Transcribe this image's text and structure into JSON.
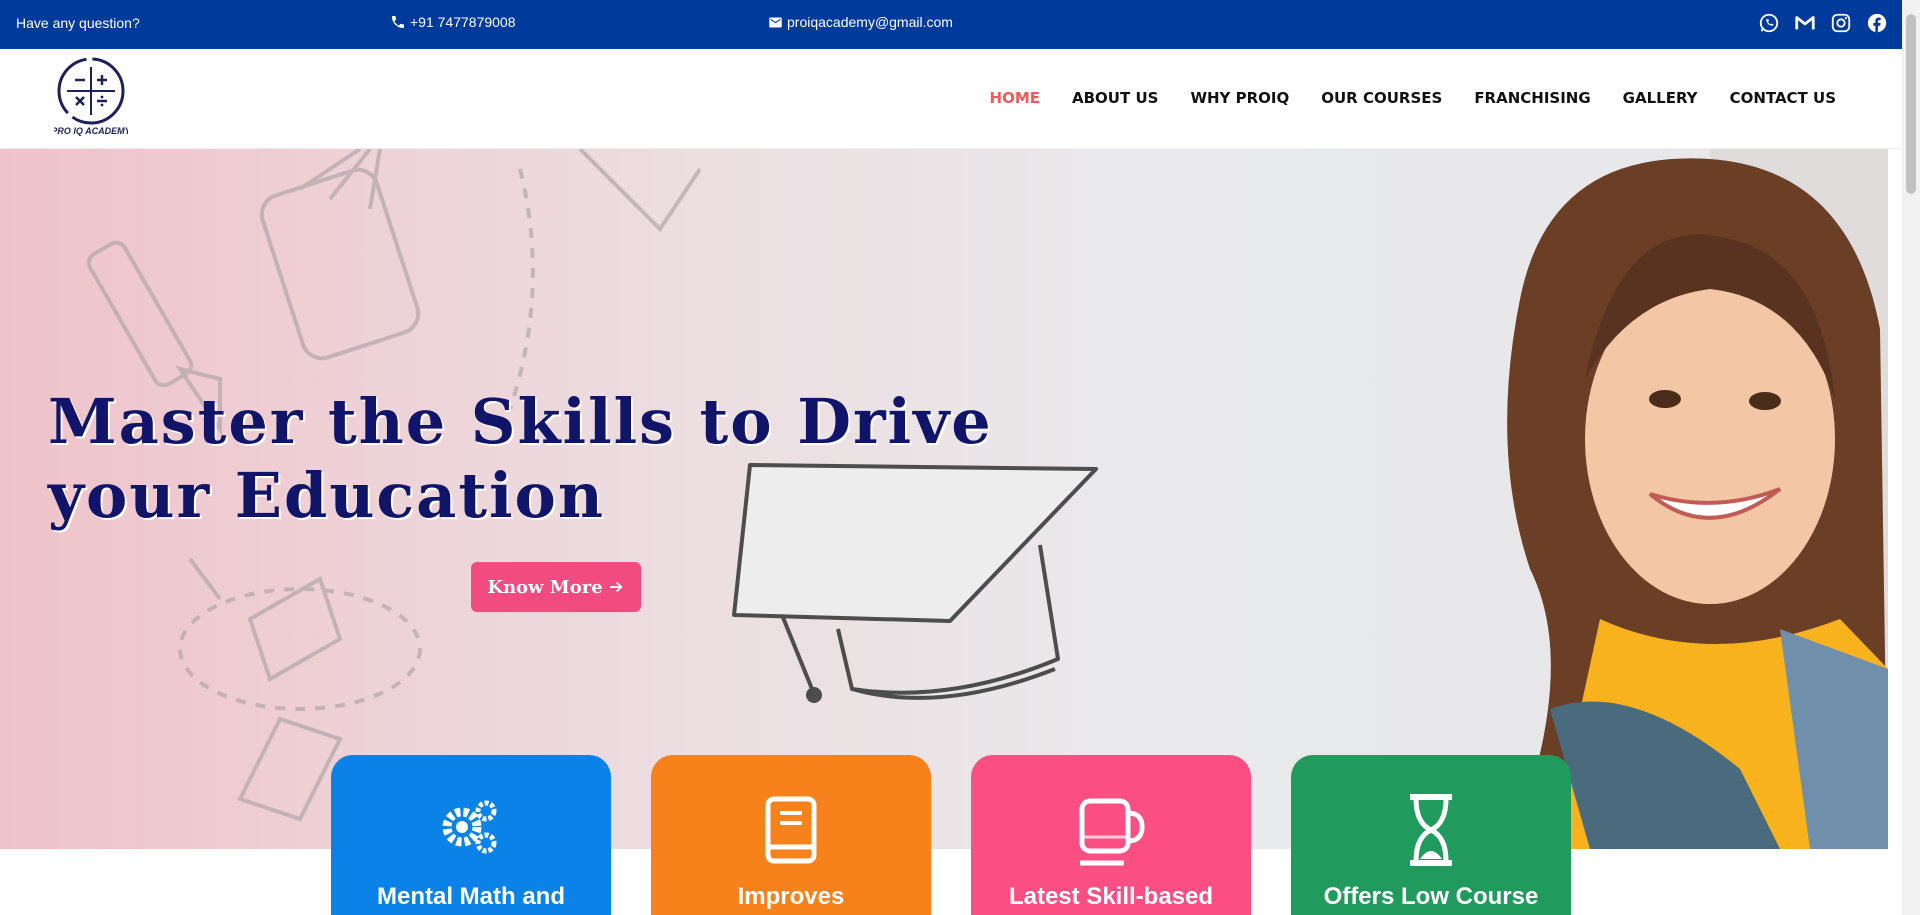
{
  "topbar": {
    "question": "Have any question?",
    "phone": "+91 7477879008",
    "email": "proiqacademy@gmail.com",
    "social_icons": [
      "whatsapp-icon",
      "gmail-icon",
      "instagram-icon",
      "facebook-icon"
    ]
  },
  "header": {
    "logo_text": "PRO IQ ACADEMY",
    "nav": [
      "HOME",
      "ABOUT US",
      "WHY PROIQ",
      "OUR COURSES",
      "FRANCHISING",
      "GALLERY",
      "CONTACT US"
    ],
    "active_nav": "HOME"
  },
  "hero": {
    "title": "Master the Skills to Drive your Education",
    "button_label": "Know More"
  },
  "cards": [
    {
      "title": "Mental Math and",
      "color": "#0a82e8",
      "icon": "gears-icon"
    },
    {
      "title": "Improves",
      "color": "#f7821b",
      "icon": "book-icon"
    },
    {
      "title": "Latest Skill-based",
      "color": "#fb4f84",
      "icon": "cup-icon"
    },
    {
      "title": "Offers Low Course",
      "color": "#219a5d",
      "icon": "hourglass-icon"
    }
  ],
  "colors": {
    "topbar": "#003a9b",
    "nav_active": "#ef5a5a",
    "title": "#11156a",
    "button": "#f24b7f"
  }
}
